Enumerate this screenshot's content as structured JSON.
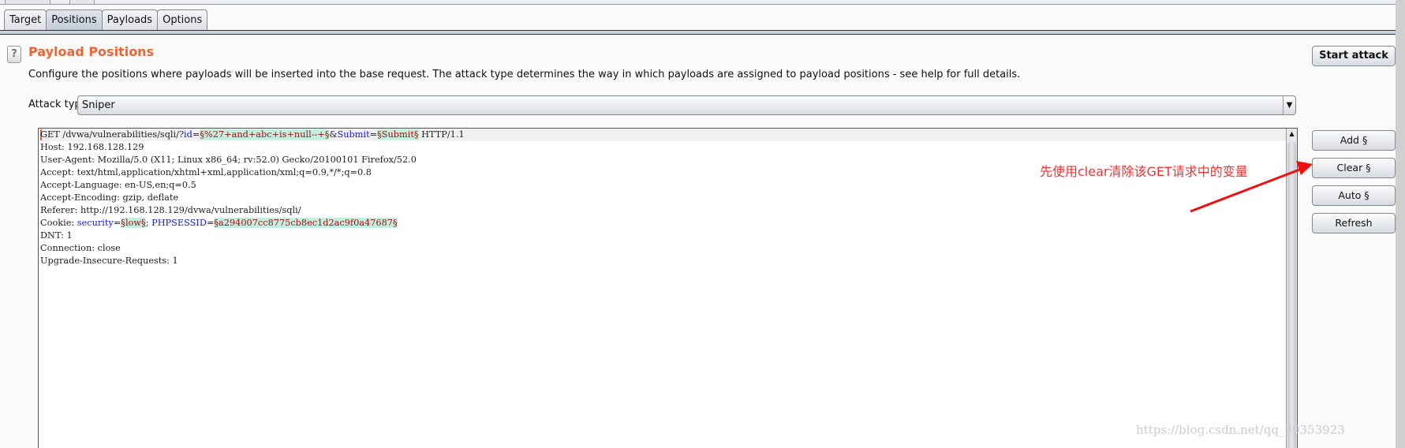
{
  "tabs": [
    {
      "label": "Target"
    },
    {
      "label": "Positions",
      "active": true
    },
    {
      "label": "Payloads"
    },
    {
      "label": "Options"
    }
  ],
  "section": {
    "help_icon": "?",
    "title": "Payload Positions",
    "description": "Configure the positions where payloads will be inserted into the base request. The attack type determines the way in which payloads are assigned to payload positions - see help for full details."
  },
  "attack_type": {
    "label": "Attack type:",
    "value": "Sniper"
  },
  "request": {
    "line1": {
      "a": "GET /dvwa/vulnerabilities/sqli/?",
      "k1": "id",
      "eq1": "=",
      "p1": "§%27+and+abc+is+null--+§",
      "amp": "&",
      "k2": "Submit",
      "eq2": "=",
      "p2": "§Submit§",
      "tail": " HTTP/1.1"
    },
    "lines": [
      "Host: 192.168.128.129",
      "User-Agent: Mozilla/5.0 (X11; Linux x86_64; rv:52.0) Gecko/20100101 Firefox/52.0",
      "Accept: text/html,application/xhtml+xml,application/xml;q=0.9,*/*;q=0.8",
      "Accept-Language: en-US,en;q=0.5",
      "Accept-Encoding: gzip, deflate",
      "Referer: http://192.168.128.129/dvwa/vulnerabilities/sqli/"
    ],
    "cookie": {
      "a": "Cookie: ",
      "k1": "security",
      "eq1": "=",
      "p1": "§low§",
      "sep": "; ",
      "k2": "PHPSESSID",
      "eq2": "=",
      "p2": "§a294007cc8775cb8ec1d2ac9f0a47687§"
    },
    "lines2": [
      "DNT: 1",
      "Connection: close",
      "Upgrade-Insecure-Requests: 1"
    ]
  },
  "buttons": {
    "start": "Start attack",
    "add": "Add §",
    "clear": "Clear §",
    "auto": "Auto §",
    "refresh": "Refresh"
  },
  "annotation": {
    "text": "先使用clear清除该GET请求中的变量",
    "color": "#f03030"
  },
  "watermark": "https://blog.csdn.net/qq_39353923",
  "colors": {
    "title": "#ef6433",
    "payload_bg": "#c4eee0",
    "keyword": "#1a1ac8"
  }
}
